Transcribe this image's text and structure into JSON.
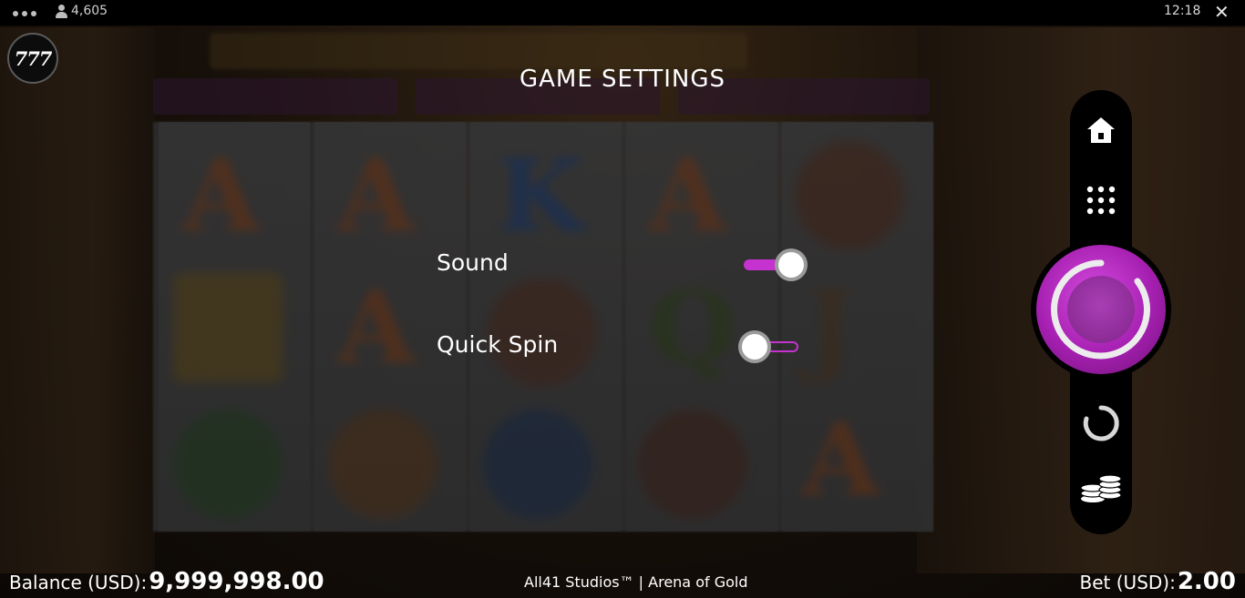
{
  "topbar": {
    "player_count": "4,605",
    "time": "12:18",
    "close_glyph": "✕",
    "menu_icon": "more-dots-icon",
    "players_icon": "person-icon"
  },
  "logo": {
    "text": "777"
  },
  "settings": {
    "title": "GAME SETTINGS",
    "items": [
      {
        "label": "Sound",
        "enabled": true
      },
      {
        "label": "Quick Spin",
        "enabled": false
      }
    ]
  },
  "side_panel": {
    "buttons": [
      "home-icon",
      "grid-menu-icon",
      "spin-button",
      "autoplay-icon",
      "bet-coins-icon"
    ]
  },
  "bottom": {
    "balance_label": "Balance (USD):",
    "balance_value": "9,999,998.00",
    "studio": "All41 Studios™ | Arena of Gold",
    "bet_label": "Bet (USD):",
    "bet_value": "2.00"
  },
  "colors": {
    "accent": "#c532cf",
    "spin_button": "#b22bbd",
    "panel": "#000000"
  }
}
